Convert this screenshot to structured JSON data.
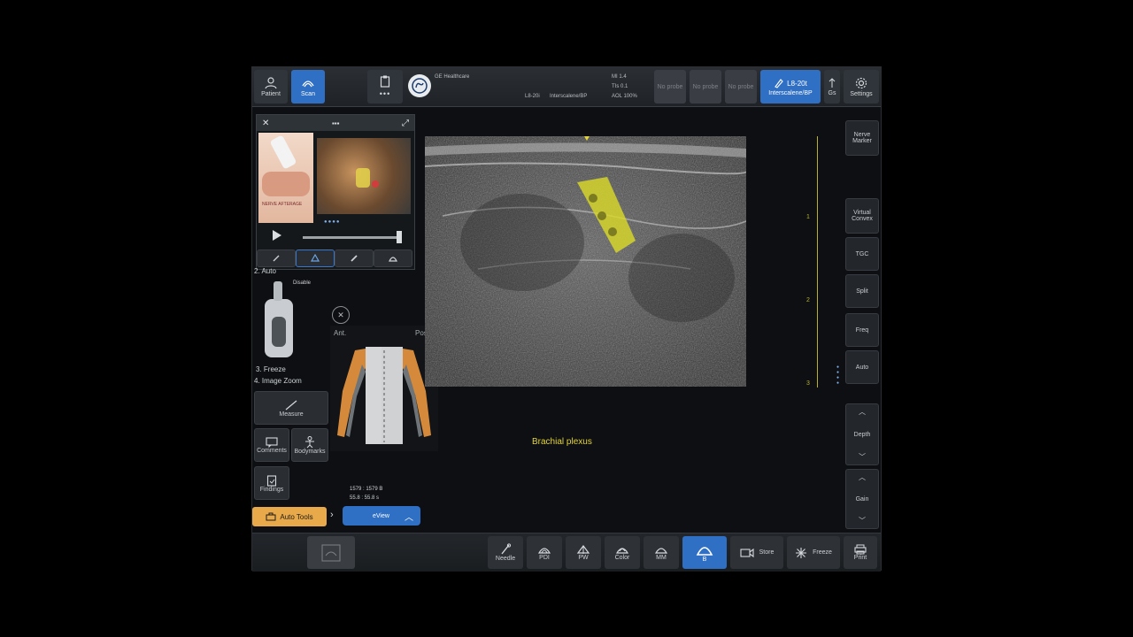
{
  "topbar": {
    "patient": "Patient",
    "scan": "Scan",
    "brand": "GE Healthcare",
    "probe": "L8-20i",
    "preset": "Interscalene/BP",
    "mi": "MI 1.4",
    "tis": "TIs 0.1",
    "aol": "AOL 100%",
    "no_probe": "No probe",
    "active_probe_line1": "L8-20t",
    "active_probe_line2": "Interscalene/BP",
    "settings": "Settings",
    "gs": "Gs"
  },
  "tutorial": {
    "image_label": "NERVE AFTERAGE",
    "auto": "2. Auto",
    "disable": "Disable",
    "freeze": "3. Freeze",
    "image_zoom": "4. Image Zoom"
  },
  "left": {
    "measure": "Measure",
    "comments": "Comments",
    "bodymarks": "Bodymarks",
    "findings": "Findings",
    "auto_tools": "Auto Tools",
    "eview": "eView",
    "counter_line1": "1579 : 1579 B",
    "counter_line2": "55.8 : 55.8 s"
  },
  "bodymark": {
    "ant": "Ant.",
    "post": "Post."
  },
  "image": {
    "structure_label": "Brachial plexus",
    "depth_ticks": [
      "1",
      "2",
      "3"
    ]
  },
  "right": {
    "nerve_marker": "Nerve Marker",
    "virtual_convex": "Virtual Convex",
    "tgc": "TGC",
    "split": "Split",
    "freq": "Freq",
    "auto": "Auto",
    "depth": "Depth",
    "gain": "Gain"
  },
  "bottombar": {
    "needle": "Needle",
    "pdi": "PDI",
    "pw": "PW",
    "color": "Color",
    "mm": "MM",
    "b": "B",
    "store": "Store",
    "freeze": "Freeze",
    "print": "Print"
  },
  "colors": {
    "accent": "#2f6fc4",
    "highlight_nerve": "#d8d82a",
    "auto_tools": "#e8a94a",
    "depth_scale": "#b9b227"
  }
}
